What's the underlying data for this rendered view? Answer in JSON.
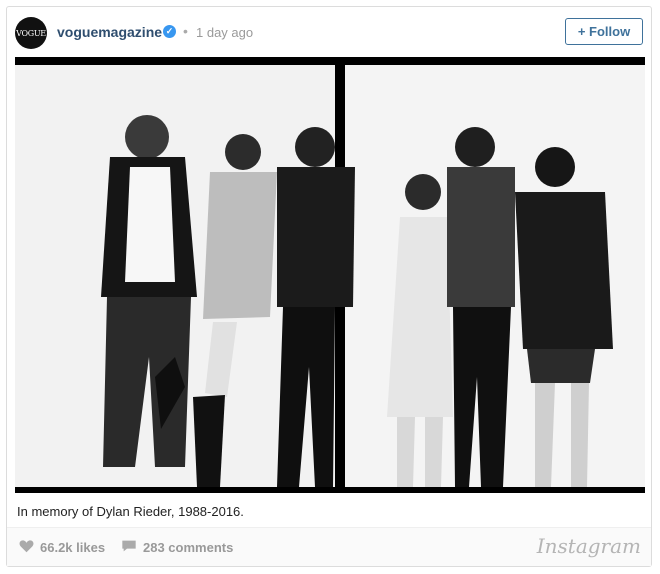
{
  "post": {
    "avatar_text": "VOGUE",
    "username": "voguemagazine",
    "verified_icon": "verified-badge-icon",
    "separator": "•",
    "time": "1 day ago",
    "follow_label": "+ Follow",
    "caption": "In memory of Dylan Rieder, 1988-2016.",
    "likes": "66.2k likes",
    "comments": "283 comments",
    "brand": "Instagram"
  },
  "colors": {
    "link": "#2f4e6f",
    "follow": "#3f729b",
    "verified": "#3897f0",
    "muted": "#999999"
  }
}
